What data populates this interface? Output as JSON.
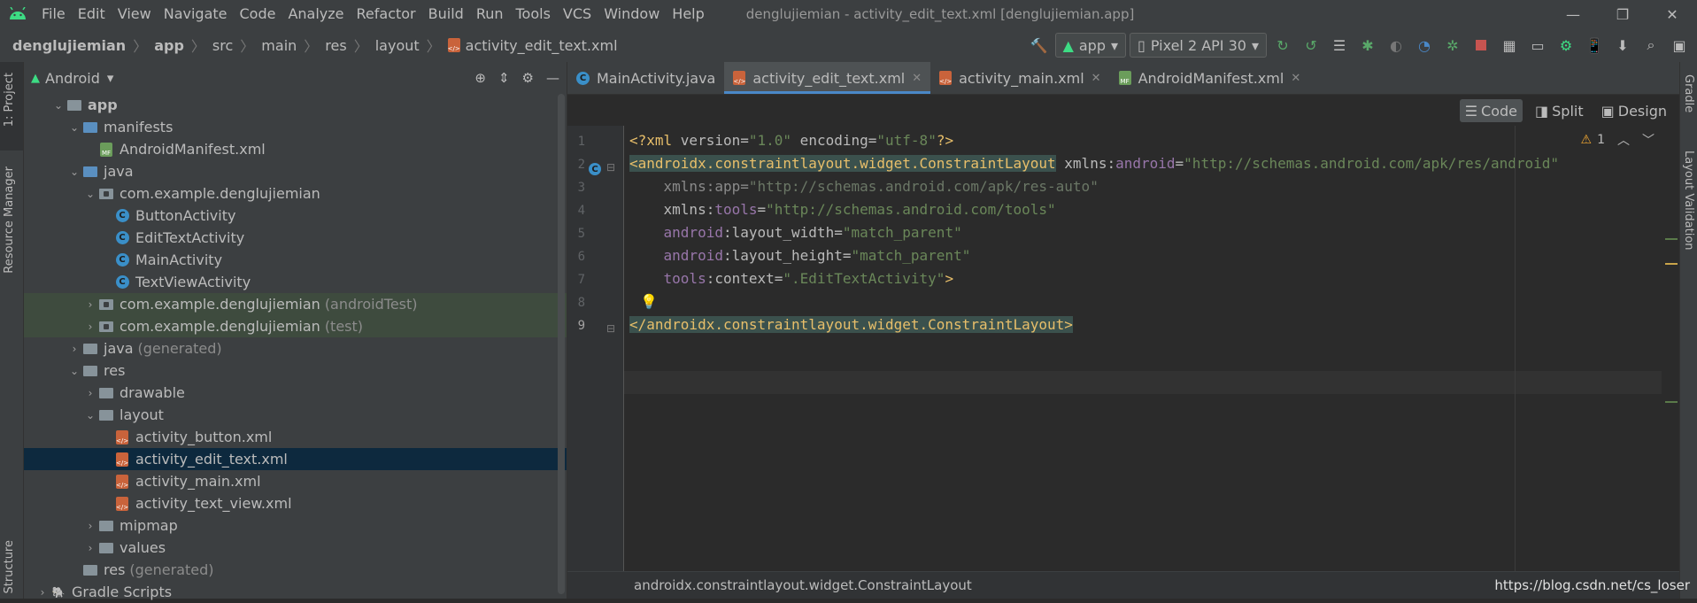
{
  "menubar": {
    "items": [
      "File",
      "Edit",
      "View",
      "Navigate",
      "Code",
      "Analyze",
      "Refactor",
      "Build",
      "Run",
      "Tools",
      "VCS",
      "Window",
      "Help"
    ],
    "title": "denglujiemian - activity_edit_text.xml [denglujiemian.app]"
  },
  "breadcrumb": [
    "denglujiemian",
    "app",
    "src",
    "main",
    "res",
    "layout",
    "activity_edit_text.xml"
  ],
  "toolbar": {
    "run_config": "app",
    "device": "Pixel 2 API 30"
  },
  "left_tabs": {
    "project": "1: Project",
    "resource_manager": "Resource Manager",
    "structure": "Structure"
  },
  "right_tabs": {
    "gradle": "Gradle",
    "layout_validation": "Layout Validation"
  },
  "project": {
    "view_mode": "Android",
    "tree": [
      {
        "label": "app",
        "bold": true
      },
      {
        "label": "manifests"
      },
      {
        "label": "AndroidManifest.xml"
      },
      {
        "label": "java"
      },
      {
        "label": "com.example.denglujiemian"
      },
      {
        "label": "ButtonActivity"
      },
      {
        "label": "EditTextActivity"
      },
      {
        "label": "MainActivity"
      },
      {
        "label": "TextViewActivity"
      },
      {
        "label": "com.example.denglujiemian",
        "suffix": "(androidTest)"
      },
      {
        "label": "com.example.denglujiemian",
        "suffix": "(test)"
      },
      {
        "label": "java",
        "suffix": "(generated)"
      },
      {
        "label": "res"
      },
      {
        "label": "drawable"
      },
      {
        "label": "layout"
      },
      {
        "label": "activity_button.xml"
      },
      {
        "label": "activity_edit_text.xml"
      },
      {
        "label": "activity_main.xml"
      },
      {
        "label": "activity_text_view.xml"
      },
      {
        "label": "mipmap"
      },
      {
        "label": "values"
      },
      {
        "label": "res",
        "suffix": "(generated)"
      },
      {
        "label": "Gradle Scripts"
      }
    ]
  },
  "editor": {
    "tabs": [
      "MainActivity.java",
      "activity_edit_text.xml",
      "activity_main.xml",
      "AndroidManifest.xml"
    ],
    "modes": [
      "Code",
      "Split",
      "Design"
    ],
    "warning_count": "1",
    "line_numbers": [
      "1",
      "2",
      "3",
      "4",
      "5",
      "6",
      "7",
      "8",
      "9"
    ],
    "code": {
      "l1": {
        "a": "<?xml ",
        "b": "version",
        "c": "=",
        "d": "\"1.0\"",
        "e": " encoding",
        "f": "=",
        "g": "\"utf-8\"",
        "h": "?>"
      },
      "l2": {
        "open": "<",
        "tag": "androidx.constraintlayout.widget.ConstraintLayout",
        "sp": " xmlns:",
        "ns": "android",
        "eq": "=",
        "val": "\"http://schemas.android.com/apk/res/android\""
      },
      "l3": {
        "attr": "xmlns:app",
        "eq": "=",
        "val": "\"http://schemas.android.com/apk/res-auto\""
      },
      "l4": {
        "attr": "xmlns:",
        "ns": "tools",
        "eq": "=",
        "val": "\"http://schemas.android.com/tools\""
      },
      "l5": {
        "ns": "android",
        "attr": ":layout_width",
        "eq": "=",
        "val": "\"match_parent\""
      },
      "l6": {
        "ns": "android",
        "attr": ":layout_height",
        "eq": "=",
        "val": "\"match_parent\""
      },
      "l7": {
        "ns": "tools",
        "attr": ":context",
        "eq": "=",
        "val": "\".EditTextActivity\"",
        "close": ">"
      },
      "l9": {
        "text": "</androidx.constraintlayout.widget.ConstraintLayout>"
      }
    },
    "status_path": "androidx.constraintlayout.widget.ConstraintLayout"
  },
  "watermark": "https://blog.csdn.net/cs_loser",
  "colors": {
    "accent": "#4a88c7",
    "tag": "#e8bf6a",
    "string": "#6a8759",
    "namespace": "#9876aa",
    "selection": "#0d293e"
  }
}
